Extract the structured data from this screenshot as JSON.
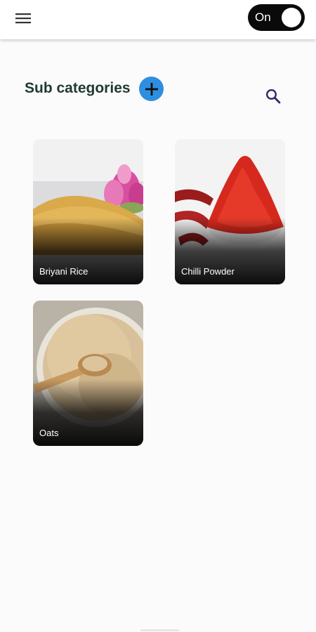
{
  "header": {
    "menu_icon": "hamburger-menu-icon",
    "toggle": {
      "label": "On",
      "state": true
    }
  },
  "page": {
    "title": "Sub categories",
    "add_icon": "plus-icon",
    "search_icon": "search-icon",
    "accent_color": "#2e8fe0"
  },
  "subcategories": [
    {
      "name": "Briyani Rice"
    },
    {
      "name": "Chilli Powder"
    },
    {
      "name": "Oats"
    }
  ]
}
